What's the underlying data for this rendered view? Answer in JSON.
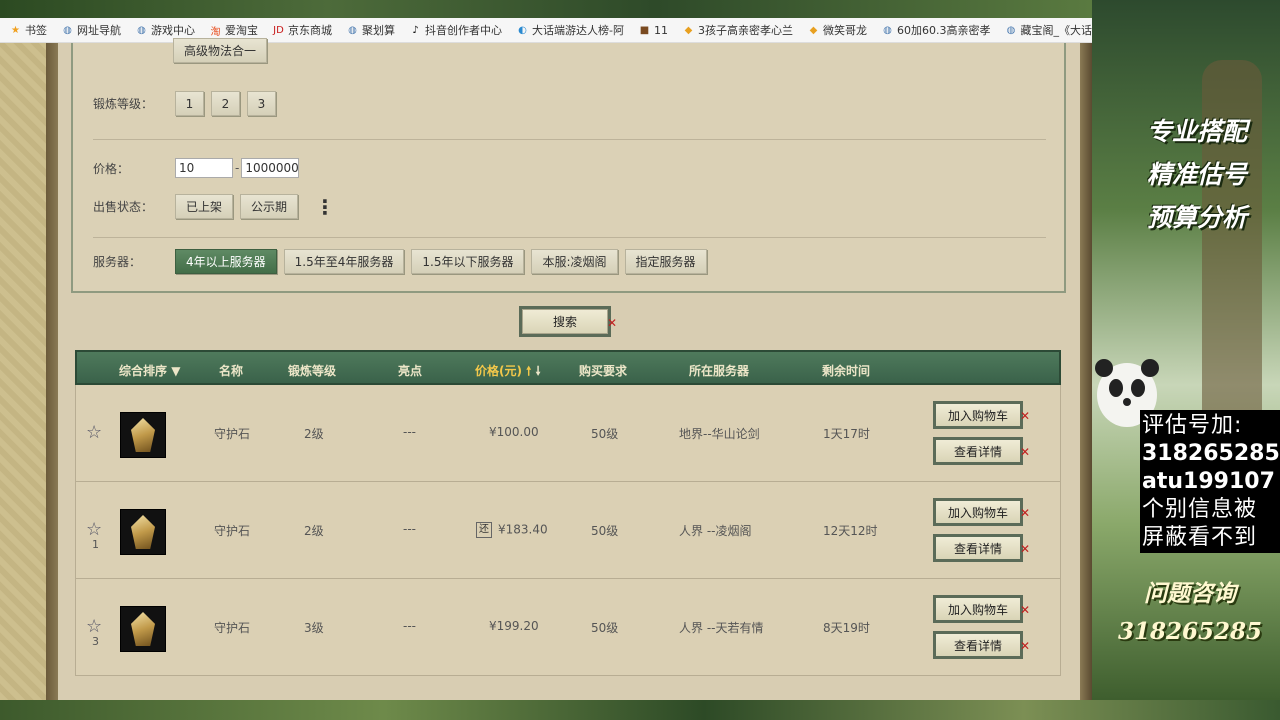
{
  "bookmarks": [
    {
      "icon": "star-icon",
      "label": "书签"
    },
    {
      "icon": "globe-icon",
      "label": "网址导航"
    },
    {
      "icon": "globe-icon",
      "label": "游戏中心"
    },
    {
      "icon": "taobao-icon",
      "label": "爱淘宝"
    },
    {
      "icon": "jd-icon",
      "label": "京东商城"
    },
    {
      "icon": "globe-icon",
      "label": "聚划算"
    },
    {
      "icon": "tiktok-icon",
      "label": "抖音创作者中心"
    },
    {
      "icon": "browser-icon",
      "label": "大话端游达人榜-阿"
    },
    {
      "icon": "game-icon",
      "label": "11"
    },
    {
      "icon": "shield-icon",
      "label": "3孩子高亲密孝心兰"
    },
    {
      "icon": "shield-icon",
      "label": "微笑哥龙"
    },
    {
      "icon": "globe-icon",
      "label": "60加60.3高亲密孝"
    },
    {
      "icon": "globe-icon",
      "label": "藏宝阁_《大话西游"
    },
    {
      "icon": "shield-icon",
      "label": ""
    }
  ],
  "filters": {
    "top_option": "高级物法合一",
    "level_label": "锻炼等级：",
    "levels": [
      "1",
      "2",
      "3"
    ],
    "price_label": "价格：",
    "price_min": "10",
    "price_max": "1000000",
    "status_label": "出售状态：",
    "statuses": [
      "已上架",
      "公示期"
    ],
    "server_label": "服务器：",
    "servers": [
      "4年以上服务器",
      "1.5年至4年服务器",
      "1.5年以下服务器",
      "本服:凌烟阁",
      "指定服务器"
    ],
    "active_server": "4年以上服务器"
  },
  "search_button": "搜索",
  "table": {
    "headers": {
      "sort": "综合排序",
      "name": "名称",
      "level": "锻炼等级",
      "highlight": "亮点",
      "price": "价格(元)",
      "requirement": "购买要求",
      "server": "所在服务器",
      "time_left": "剩余时间"
    },
    "rows": [
      {
        "fav_count": "",
        "name": "守护石",
        "level": "2级",
        "highlight": "---",
        "returnable": false,
        "price": "¥100.00",
        "requirement": "50级",
        "server": "地界--华山论剑",
        "time_left": "1天17时"
      },
      {
        "fav_count": "1",
        "name": "守护石",
        "level": "2级",
        "highlight": "---",
        "returnable": true,
        "price": "¥183.40",
        "requirement": "50级",
        "server": "人界 --凌烟阁",
        "time_left": "12天12时"
      },
      {
        "fav_count": "3",
        "name": "守护石",
        "level": "3级",
        "highlight": "---",
        "returnable": false,
        "price": "¥199.20",
        "requirement": "50级",
        "server": "人界 --天若有情",
        "time_left": "8天19时"
      }
    ],
    "returnable_badge": "还",
    "add_cart_label": "加入购物车",
    "details_label": "查看详情"
  },
  "promo": {
    "slogans": [
      "专业搭配",
      "精准估号",
      "预算分析"
    ],
    "contact_lines": [
      "评估号加:",
      "318265285",
      "atu199107",
      "个别信息被",
      "屏蔽看不到"
    ],
    "consult_lines": [
      "问题咨询",
      "318265285"
    ]
  }
}
